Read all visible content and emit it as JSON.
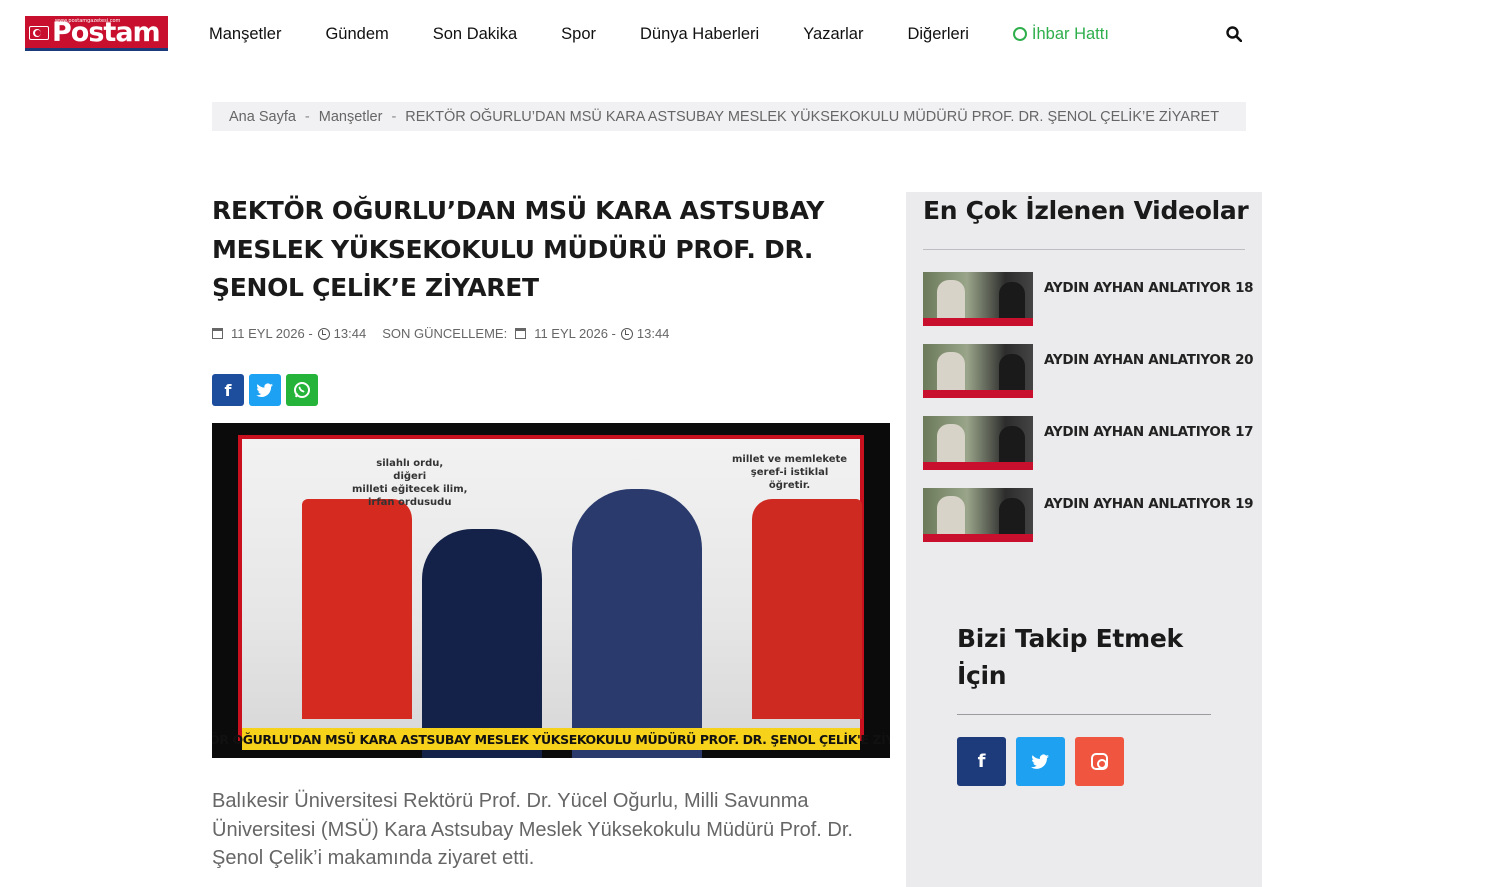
{
  "header": {
    "logo": {
      "name": "Postam",
      "tagline": "www.postamgazetesi.com"
    },
    "nav": [
      {
        "label": "Manşetler"
      },
      {
        "label": "Gündem"
      },
      {
        "label": "Son Dakika"
      },
      {
        "label": "Spor"
      },
      {
        "label": "Dünya Haberleri"
      },
      {
        "label": "Yazarlar"
      },
      {
        "label": "Diğerleri"
      },
      {
        "label": "İhbar Hattı",
        "color": "#2eaf4c",
        "icon": "whatsapp-icon"
      }
    ],
    "search_icon": "search-icon"
  },
  "breadcrumb": {
    "home": "Ana Sayfa",
    "separator": "-",
    "category": "Manşetler",
    "current": "REKTÖR OĞURLU’DAN MSÜ KARA ASTSUBAY MESLEK YÜKSEKOKULU MÜDÜRÜ PROF. DR. ŞENOL ÇELİK’E ZİYARET"
  },
  "article": {
    "title": "REKTÖR OĞURLU’DAN MSÜ KARA ASTSUBAY MESLEK YÜKSEKOKULU MÜDÜRÜ PROF. DR. ŞENOL ÇELİK’E ZİYARET",
    "date": "11 EYL 2026 -",
    "time": "13:44",
    "updated_label": "SON GÜNCELLEME:",
    "updated_date": "11 EYL 2026 -",
    "updated_time": "13:44",
    "share": [
      {
        "icon": "facebook-icon",
        "glyph": "f",
        "color": "#1d4e9e"
      },
      {
        "icon": "twitter-icon",
        "glyph": "t",
        "color": "#1da1f2"
      },
      {
        "icon": "whatsapp-icon",
        "glyph": "w",
        "color": "#25b33a"
      }
    ],
    "image": {
      "caption": "REKTÖR OĞURLU'DAN MSÜ KARA ASTSUBAY MESLEK YÜKSEKOKULU MÜDÜRÜ PROF. DR. ŞENOL ÇELİK'E ZİYARET",
      "quote_left": "silahlı ordu,\ndiğeri\nmilleti eğitecek ilim,\nirfan ordusudu",
      "quote_right": "millet ve memlekete\nşeref-i istiklal\nöğretir."
    },
    "lead": "Balıkesir Üniversitesi Rektörü Prof. Dr. Yücel Oğurlu, Milli Savunma Üniversitesi (MSÜ) Kara Astsubay Meslek Yüksekokulu Müdürü Prof. Dr. Şenol Çelik’i makamında ziyaret etti."
  },
  "sidebar": {
    "videos_title": "En Çok İzlenen Videolar",
    "videos": [
      {
        "title": "AYDIN AYHAN ANLATIYOR 18"
      },
      {
        "title": "AYDIN AYHAN ANLATIYOR 20"
      },
      {
        "title": "AYDIN AYHAN ANLATIYOR 17"
      },
      {
        "title": "AYDIN AYHAN ANLATIYOR 19"
      }
    ],
    "follow_title": "Bizi Takip Etmek İçin",
    "social": [
      {
        "icon": "facebook-icon",
        "glyph": "f",
        "color": "#1d3a7a"
      },
      {
        "icon": "twitter-icon",
        "glyph": "t",
        "color": "#1ea1f1"
      },
      {
        "icon": "instagram-icon",
        "color": "#f0553f"
      }
    ]
  }
}
